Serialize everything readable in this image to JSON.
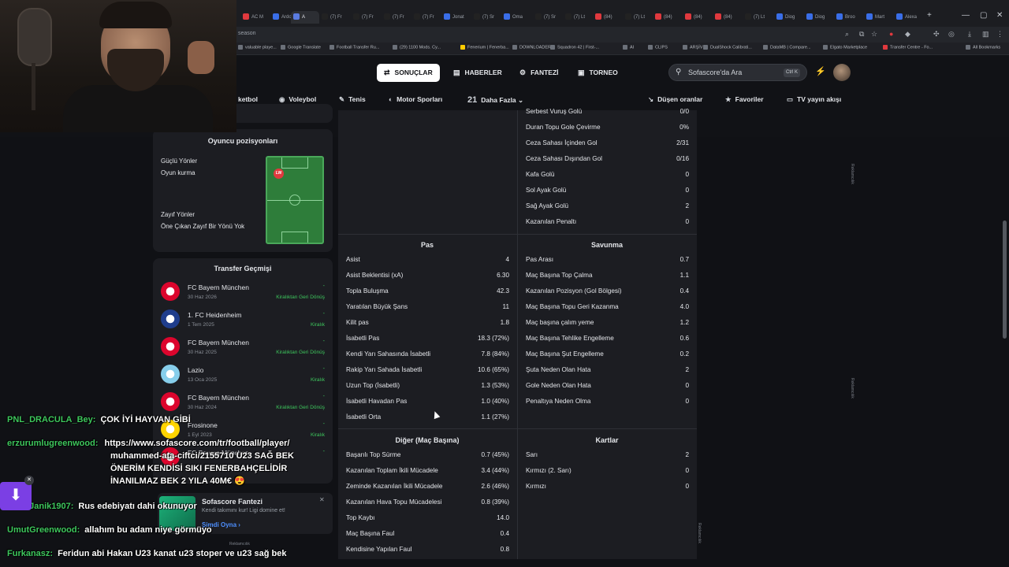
{
  "browser": {
    "tabs": [
      "AC M",
      "Ardo",
      "A",
      "(7) Fr",
      "(7) Fr",
      "(7) Fr",
      "(7) Fr",
      "Jonat",
      "(7) Sr",
      "Oma",
      "(7) Sr",
      "(7) Lt",
      "(84)",
      "(7) Lt",
      "(84)",
      "(84)",
      "(84)",
      "(7) Lt",
      "Diog",
      "Diog",
      "Broo",
      "Mart",
      "Alexa"
    ],
    "url": "season",
    "bookmarks": [
      "valuable playe...",
      "Google Translate",
      "Football Transfer Ru...",
      "(29) 1100 Mods. Cy...",
      "Fenerium | Fenerba...",
      "DOWNLOADERS",
      "Squadron 42 | First-...",
      "AI",
      "CLIPS",
      "ARŞİV",
      "DualShock Calibrati...",
      "DataMB | Compare...",
      "Elgato Marketplace",
      "Transfer Centre - Fo...",
      "All Bookmarks"
    ]
  },
  "nav": {
    "tabs": [
      {
        "label": "SONUÇLAR",
        "icon": "⇄"
      },
      {
        "label": "HABERLER",
        "icon": "▤"
      },
      {
        "label": "FANTEZİ",
        "icon": "⚙"
      },
      {
        "label": "TORNEO",
        "icon": "▣"
      }
    ],
    "search_placeholder": "Sofascore'da Ara",
    "search_kbd": "Ctrl K",
    "sports": [
      {
        "label": "ketbol",
        "icon": ""
      },
      {
        "label": "Voleybol",
        "icon": "◉"
      },
      {
        "label": "Tenis",
        "icon": "✎"
      },
      {
        "label": "Motor Sporları",
        "icon": "◐"
      },
      {
        "label": "Daha Fazla",
        "icon": "21"
      }
    ],
    "right": [
      {
        "label": "Düşen oranlar",
        "icon": "↘"
      },
      {
        "label": "Favoriler",
        "icon": "★"
      },
      {
        "label": "TV yayın akışı",
        "icon": "▭"
      }
    ]
  },
  "positions": {
    "title": "Oyuncu pozisyonları",
    "strong_label": "Güçlü Yönler",
    "strong_value": "Oyun kurma",
    "weak_label": "Zayıf Yönler",
    "weak_value": "Öne Çıkan Zayıf Bir Yönü Yok",
    "position": "LW"
  },
  "transfers": {
    "title": "Transfer Geçmişi",
    "rows": [
      {
        "team": "FC Bayern München",
        "date": "30 Haz 2026",
        "fee": "-",
        "type": "Kiralıktan Geri Dönüş",
        "logo": "#dc052d"
      },
      {
        "team": "1. FC Heidenheim",
        "date": "1 Tem 2025",
        "fee": "-",
        "type": "Kiralık",
        "logo": "#1f3d8c"
      },
      {
        "team": "FC Bayern München",
        "date": "30 Haz 2025",
        "fee": "-",
        "type": "Kiralıktan Geri Dönüş",
        "logo": "#dc052d"
      },
      {
        "team": "Lazio",
        "date": "13 Oca 2025",
        "fee": "-",
        "type": "Kiralık",
        "logo": "#87ceeb"
      },
      {
        "team": "FC Bayern München",
        "date": "30 Haz 2024",
        "fee": "-",
        "type": "Kiralıktan Geri Dönüş",
        "logo": "#dc052d"
      },
      {
        "team": "Frosinone",
        "date": "1 Eyl 2023",
        "fee": "-",
        "type": "Kiralık",
        "logo": "#ffd400"
      },
      {
        "team": "FC Bayern München",
        "date": "",
        "fee": "-",
        "type": "",
        "logo": "#dc052d"
      }
    ]
  },
  "stats": {
    "top_right": [
      {
        "label": "Serbest Vuruş Golü",
        "value": "0/0"
      },
      {
        "label": "Duran Topu Gole Çevirme",
        "value": "0%"
      },
      {
        "label": "Ceza Sahası İçinden Gol",
        "value": "2/31"
      },
      {
        "label": "Ceza Sahası Dışından Gol",
        "value": "0/16"
      },
      {
        "label": "Kafa Golü",
        "value": "0"
      },
      {
        "label": "Sol Ayak Golü",
        "value": "0"
      },
      {
        "label": "Sağ Ayak Golü",
        "value": "2"
      },
      {
        "label": "Kazanılan Penaltı",
        "value": "0"
      }
    ],
    "pas_title": "Pas",
    "pas": [
      {
        "label": "Asist",
        "value": "4"
      },
      {
        "label": "Asist Beklentisi (xA)",
        "value": "6.30"
      },
      {
        "label": "Topla Buluşma",
        "value": "42.3"
      },
      {
        "label": "Yaratılan Büyük Şans",
        "value": "11"
      },
      {
        "label": "Kilit pas",
        "value": "1.8"
      },
      {
        "label": "İsabetli Pas",
        "value": "18.3 (72%)"
      },
      {
        "label": "Kendi Yarı Sahasında İsabetli",
        "value": "7.8 (84%)"
      },
      {
        "label": "Rakip Yarı Sahada İsabetli",
        "value": "10.6 (65%)"
      },
      {
        "label": "Uzun Top (İsabetli)",
        "value": "1.3 (53%)"
      },
      {
        "label": "İsabetli Havadan Pas",
        "value": "1.0 (40%)"
      },
      {
        "label": "İsabetli Orta",
        "value": "1.1 (27%)"
      }
    ],
    "savunma_title": "Savunma",
    "savunma": [
      {
        "label": "Pas Arası",
        "value": "0.7"
      },
      {
        "label": "Maç Başına Top Çalma",
        "value": "1.1"
      },
      {
        "label": "Kazanılan Pozisyon (Gol Bölgesi)",
        "value": "0.4"
      },
      {
        "label": "Maç Başına Topu Geri Kazanma",
        "value": "4.0"
      },
      {
        "label": "Maç başına çalım yeme",
        "value": "1.2"
      },
      {
        "label": "Maç Başına Tehlike Engelleme",
        "value": "0.6"
      },
      {
        "label": "Maç Başına Şut Engelleme",
        "value": "0.2"
      },
      {
        "label": "Şuta Neden Olan Hata",
        "value": "2"
      },
      {
        "label": "Gole Neden Olan Hata",
        "value": "0"
      },
      {
        "label": "Penaltıya Neden Olma",
        "value": "0"
      }
    ],
    "diger_title": "Diğer (Maç Başına)",
    "diger": [
      {
        "label": "Başarılı Top Sürme",
        "value": "0.7 (45%)"
      },
      {
        "label": "Kazanılan Toplam İkili Mücadele",
        "value": "3.4 (44%)"
      },
      {
        "label": "Zeminde Kazanılan İkili Mücadele",
        "value": "2.6 (46%)"
      },
      {
        "label": "Kazanılan Hava Topu Mücadelesi",
        "value": "0.8 (39%)"
      },
      {
        "label": "Top Kaybı",
        "value": "14.0"
      },
      {
        "label": "Maç Başına Faul",
        "value": "0.4"
      },
      {
        "label": "Kendisine Yapılan Faul",
        "value": "0.8"
      }
    ],
    "kartlar_title": "Kartlar",
    "kartlar": [
      {
        "label": "Sarı",
        "value": "2"
      },
      {
        "label": "Kırmızı (2. Sarı)",
        "value": "0"
      },
      {
        "label": "Kırmızı",
        "value": "0"
      }
    ]
  },
  "ads": {
    "label": "Reklamcılık"
  },
  "fantezi_promo": {
    "title": "Sofascore Fantezi",
    "text": "Kendi takımını kur! Ligi domine et!",
    "cta": "Şimdi Oyna"
  },
  "chat": [
    {
      "user": "PNL_DRACULA_Bey:",
      "color": "#3ec75d",
      "msg": "ÇOK İYİ HAYVAN GİBİ"
    },
    {
      "user": "erzurumlugreenwood:",
      "color": "#3ec75d",
      "msg": "https://www.sofascore.com/tr/football/player/"
    },
    {
      "user": "",
      "color": "#ffffff",
      "msg": "muhammed-ata-ciftci/2155710 U23 SAĞ BEK"
    },
    {
      "user": "",
      "color": "#ffffff",
      "msg": "ÖNERİM KENDİSİ SIKI FENERBAHÇELİDİR"
    },
    {
      "user": "",
      "color": "#ffffff",
      "msg": "İNANILMAZ BEK 2 YILA 40M€ 😍"
    },
    {
      "user": "MusaJanik1907:",
      "color": "#3ec75d",
      "msg": "Rus edebiyatı dahi okunuyor"
    },
    {
      "user": "UmutGreenwood:",
      "color": "#3ec75d",
      "msg": "allahım bu adam niye görmüyo"
    },
    {
      "user": "Furkanasz:",
      "color": "#3ec75d",
      "msg": "Feridun abi Hakan U23 kanat u23 stoper ve u23 sağ bek"
    }
  ]
}
